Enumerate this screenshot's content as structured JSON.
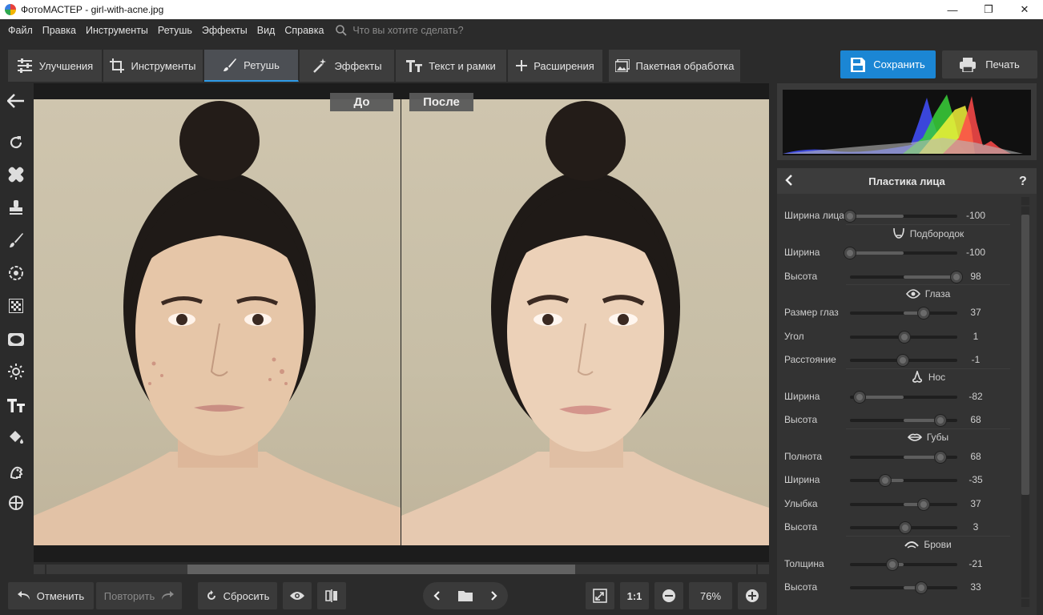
{
  "window": {
    "title": "ФотоМАСТЕР - girl-with-acne.jpg",
    "minimize": "—",
    "maximize": "❐",
    "close": "✕"
  },
  "menu": {
    "items": [
      "Файл",
      "Правка",
      "Инструменты",
      "Ретушь",
      "Эффекты",
      "Вид",
      "Справка"
    ],
    "search_placeholder": "Что вы хотите сделать?"
  },
  "tabs": [
    {
      "label": "Улучшения",
      "icon": "sliders-icon"
    },
    {
      "label": "Инструменты",
      "icon": "crop-icon"
    },
    {
      "label": "Ретушь",
      "icon": "brush-icon",
      "active": true
    },
    {
      "label": "Эффекты",
      "icon": "magic-wand-icon"
    },
    {
      "label": "Текст и рамки",
      "icon": "text-icon"
    },
    {
      "label": "Расширения",
      "icon": "plus-icon"
    },
    {
      "label": "Пакетная обработка",
      "icon": "images-icon"
    }
  ],
  "actions": {
    "save": "Сохранить",
    "print": "Печать"
  },
  "left_tools": [
    "back-arrow-icon",
    "rotate-icon",
    "patch-icon",
    "stamp-icon",
    "brush-icon",
    "target-icon",
    "grid-icon",
    "vignette-icon",
    "sun-icon",
    "text-icon",
    "fill-icon",
    "face-icon",
    "crosshair-icon"
  ],
  "canvas": {
    "before_label": "До",
    "after_label": "После"
  },
  "bottom": {
    "undo": "Отменить",
    "redo": "Повторить",
    "reset": "Сбросить",
    "zoom_ratio": "1:1",
    "zoom": "76%"
  },
  "panel": {
    "title": "Пластика лица",
    "help": "?",
    "face_width": {
      "label": "Ширина лица",
      "value": "-100",
      "level": -100
    },
    "sections": [
      {
        "title": "Подбородок",
        "icon": "chin-icon",
        "rows": [
          {
            "label": "Ширина",
            "value": "-100",
            "level": -100
          },
          {
            "label": "Высота",
            "value": "98",
            "level": 98
          }
        ]
      },
      {
        "title": "Глаза",
        "icon": "eye-icon",
        "rows": [
          {
            "label": "Размер глаз",
            "value": "37",
            "level": 37
          },
          {
            "label": "Угол",
            "value": "1",
            "level": 1
          },
          {
            "label": "Расстояние",
            "value": "-1",
            "level": -1
          }
        ]
      },
      {
        "title": "Нос",
        "icon": "nose-icon",
        "rows": [
          {
            "label": "Ширина",
            "value": "-82",
            "level": -82
          },
          {
            "label": "Высота",
            "value": "68",
            "level": 68
          }
        ]
      },
      {
        "title": "Губы",
        "icon": "lips-icon",
        "rows": [
          {
            "label": "Полнота",
            "value": "68",
            "level": 68
          },
          {
            "label": "Ширина",
            "value": "-35",
            "level": -35
          },
          {
            "label": "Улыбка",
            "value": "37",
            "level": 37
          },
          {
            "label": "Высота",
            "value": "3",
            "level": 3
          }
        ]
      },
      {
        "title": "Брови",
        "icon": "brow-icon",
        "rows": [
          {
            "label": "Толщина",
            "value": "-21",
            "level": -21
          },
          {
            "label": "Высота",
            "value": "33",
            "level": 33
          }
        ]
      }
    ]
  },
  "colors": {
    "accent": "#1b86d4",
    "panel": "#333333",
    "bg": "#2b2b2b"
  }
}
